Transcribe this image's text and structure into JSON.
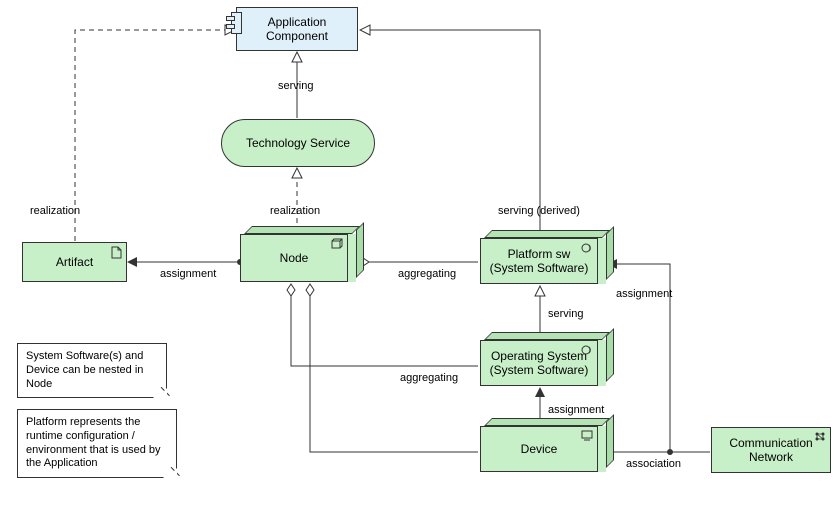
{
  "nodes": {
    "app_component": "Application\nComponent",
    "tech_service": "Technology Service",
    "artifact": "Artifact",
    "node": "Node",
    "platform_sw": "Platform sw\n(System Software)",
    "operating_system": "Operating System\n(System Software)",
    "device": "Device",
    "comm_network": "Communication\nNetwork"
  },
  "edges": {
    "realization1": "realization",
    "realization2": "realization",
    "serving1": "serving",
    "serving_derived": "serving (derived)",
    "assignment1": "assignment",
    "aggregating1": "aggregating",
    "serving2": "serving",
    "aggregating2": "aggregating",
    "assignment2": "assignment",
    "assignment3": "assignment",
    "association": "association"
  },
  "notes": {
    "note1": "System Software(s) and Device can be nested in Node",
    "note2": "Platform represents the runtime configuration / environment that is used by the Application"
  }
}
